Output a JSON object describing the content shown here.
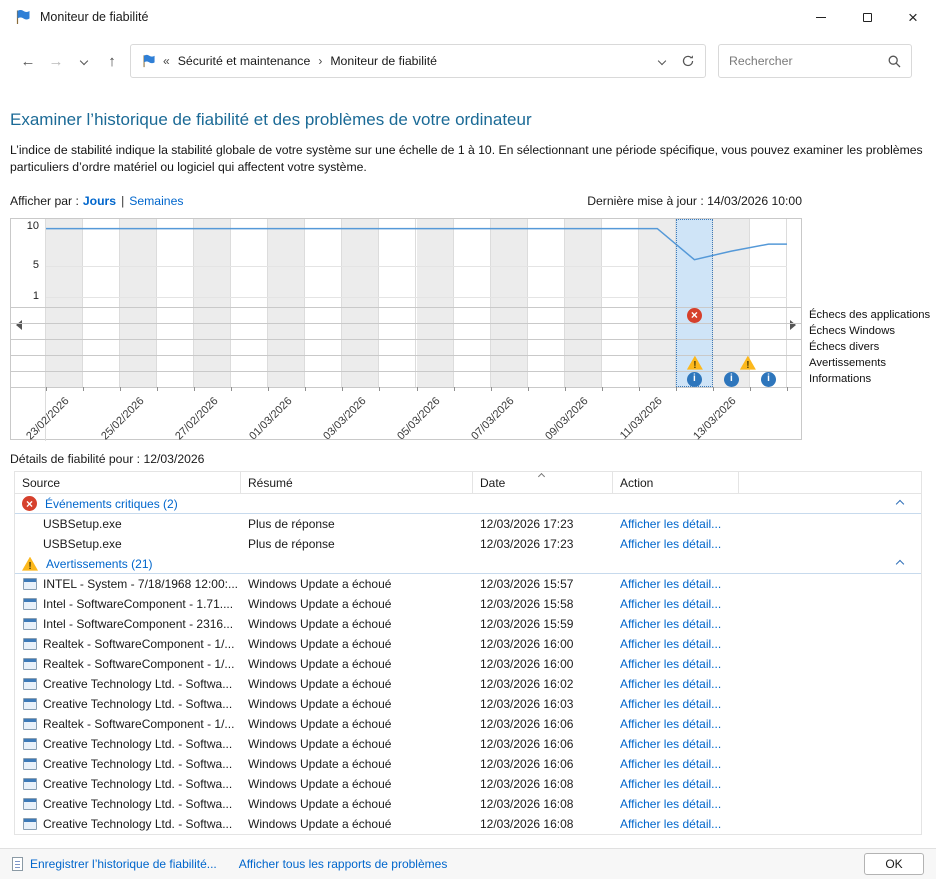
{
  "theme": {
    "link": "#0066cc",
    "heading": "#1b6a96",
    "error": "#d6402c",
    "warning": "#fcb81c",
    "info": "#2e76bc",
    "selection-fill": "#cfe4f7",
    "selection-border": "#3d7ab8",
    "chart-line": "#5599d8"
  },
  "window": {
    "title": "Moniteur de fiabilité"
  },
  "navbar": {
    "crumb_prefix": "«",
    "crumb_separator": "›",
    "crumbs": [
      "Sécurité et maintenance",
      "Moniteur de fiabilité"
    ],
    "search_placeholder": "Rechercher"
  },
  "page": {
    "heading": "Examiner l’historique de fiabilité et des problèmes de votre ordinateur",
    "description": "L’indice de stabilité indique la stabilité globale de votre système sur une échelle de 1 à 10. En sélectionnant une période spécifique, vous pouvez examiner les problèmes particuliers d’ordre matériel ou logiciel qui affectent votre système.",
    "view_by_label": "Afficher par :",
    "view_options": {
      "days": "Jours",
      "separator": "|",
      "weeks": "Semaines"
    },
    "last_update": "Dernière mise à jour : 14/03/2026 10:00"
  },
  "chart_data": {
    "type": "line",
    "ylim": [
      1,
      10
    ],
    "y_ticks": [
      10,
      5,
      1
    ],
    "num_columns": 20,
    "selected_column": 17,
    "selected_date": "12/03/2026",
    "x_labels": [
      "23/02/2026",
      "25/02/2026",
      "27/02/2026",
      "01/03/2026",
      "03/03/2026",
      "05/03/2026",
      "07/03/2026",
      "09/03/2026",
      "11/03/2026",
      "13/03/2026"
    ],
    "stability_index": [
      9.8,
      9.8,
      9.8,
      9.8,
      9.8,
      9.8,
      9.8,
      9.8,
      9.8,
      9.8,
      9.8,
      9.8,
      9.8,
      9.8,
      9.8,
      9.8,
      9.8,
      5.8,
      6.9,
      7.8
    ],
    "event_rows": [
      {
        "label": "Échecs des applications",
        "markers": {
          "17": "error"
        }
      },
      {
        "label": "Échecs Windows",
        "markers": {}
      },
      {
        "label": "Échecs divers",
        "markers": {}
      },
      {
        "label": "Avertissements",
        "markers": {
          "17": "warning",
          "18": "warning"
        }
      },
      {
        "label": "Informations",
        "markers": {
          "17": "info",
          "18": "info",
          "19": "info"
        }
      }
    ]
  },
  "details": {
    "title": "Détails de fiabilité pour : 12/03/2026",
    "columns": [
      "Source",
      "Résumé",
      "Date",
      "Action"
    ],
    "groups": [
      {
        "icon": "error",
        "label": "Événements critiques (2)",
        "rows": [
          {
            "icon": "none",
            "source": "USBSetup.exe",
            "summary": "Plus de réponse",
            "date": "12/03/2026 17:23",
            "action": "Afficher les détail..."
          },
          {
            "icon": "none",
            "source": "USBSetup.exe",
            "summary": "Plus de réponse",
            "date": "12/03/2026 17:23",
            "action": "Afficher les détail..."
          }
        ]
      },
      {
        "icon": "warning",
        "label": "Avertissements (21)",
        "rows": [
          {
            "icon": "app",
            "source": "INTEL - System - 7/18/1968 12:00:...",
            "summary": "Windows Update a échoué",
            "date": "12/03/2026 15:57",
            "action": "Afficher les détail..."
          },
          {
            "icon": "app",
            "source": "Intel - SoftwareComponent - 1.71....",
            "summary": "Windows Update a échoué",
            "date": "12/03/2026 15:58",
            "action": "Afficher les détail..."
          },
          {
            "icon": "app",
            "source": "Intel - SoftwareComponent - 2316...",
            "summary": "Windows Update a échoué",
            "date": "12/03/2026 15:59",
            "action": "Afficher les détail..."
          },
          {
            "icon": "app",
            "source": "Realtek - SoftwareComponent - 1/...",
            "summary": "Windows Update a échoué",
            "date": "12/03/2026 16:00",
            "action": "Afficher les détail..."
          },
          {
            "icon": "app",
            "source": "Realtek - SoftwareComponent - 1/...",
            "summary": "Windows Update a échoué",
            "date": "12/03/2026 16:00",
            "action": "Afficher les détail..."
          },
          {
            "icon": "app",
            "source": "Creative Technology Ltd. - Softwa...",
            "summary": "Windows Update a échoué",
            "date": "12/03/2026 16:02",
            "action": "Afficher les détail..."
          },
          {
            "icon": "app",
            "source": "Creative Technology Ltd. - Softwa...",
            "summary": "Windows Update a échoué",
            "date": "12/03/2026 16:03",
            "action": "Afficher les détail..."
          },
          {
            "icon": "app",
            "source": "Realtek - SoftwareComponent - 1/...",
            "summary": "Windows Update a échoué",
            "date": "12/03/2026 16:06",
            "action": "Afficher les détail..."
          },
          {
            "icon": "app",
            "source": "Creative Technology Ltd. - Softwa...",
            "summary": "Windows Update a échoué",
            "date": "12/03/2026 16:06",
            "action": "Afficher les détail..."
          },
          {
            "icon": "app",
            "source": "Creative Technology Ltd. - Softwa...",
            "summary": "Windows Update a échoué",
            "date": "12/03/2026 16:06",
            "action": "Afficher les détail..."
          },
          {
            "icon": "app",
            "source": "Creative Technology Ltd. - Softwa...",
            "summary": "Windows Update a échoué",
            "date": "12/03/2026 16:08",
            "action": "Afficher les détail..."
          },
          {
            "icon": "app",
            "source": "Creative Technology Ltd. - Softwa...",
            "summary": "Windows Update a échoué",
            "date": "12/03/2026 16:08",
            "action": "Afficher les détail..."
          },
          {
            "icon": "app",
            "source": "Creative Technology Ltd. - Softwa...",
            "summary": "Windows Update a échoué",
            "date": "12/03/2026 16:08",
            "action": "Afficher les détail..."
          }
        ]
      }
    ]
  },
  "footer": {
    "save_link": "Enregistrer l’historique de fiabilité...",
    "reports_link": "Afficher tous les rapports de problèmes",
    "ok_button": "OK"
  }
}
